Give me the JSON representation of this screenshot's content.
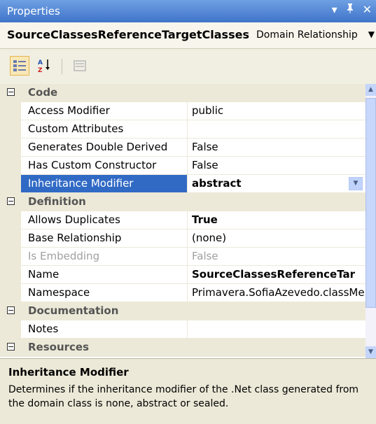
{
  "window": {
    "title": "Properties",
    "controls": {
      "dropdown": "▾",
      "pin": "ᵖ",
      "close": "✕"
    }
  },
  "selector": {
    "object_name": "SourceClassesReferenceTargetClasses",
    "object_type": "Domain Relationship"
  },
  "grid": {
    "categories": [
      {
        "label": "Code",
        "properties": [
          {
            "name": "Access Modifier",
            "value": "public"
          },
          {
            "name": "Custom Attributes",
            "value": ""
          },
          {
            "name": "Generates Double Derived",
            "value": "False"
          },
          {
            "name": "Has Custom Constructor",
            "value": "False"
          },
          {
            "name": "Inheritance Modifier",
            "value": "abstract"
          }
        ]
      },
      {
        "label": "Definition",
        "properties": [
          {
            "name": "Allows Duplicates",
            "value": "True"
          },
          {
            "name": "Base Relationship",
            "value": "(none)"
          },
          {
            "name": "Is Embedding",
            "value": "False"
          },
          {
            "name": "Name",
            "value": "SourceClassesReferenceTar"
          },
          {
            "name": "Namespace",
            "value": "Primavera.SofiaAzevedo.classMe"
          }
        ]
      },
      {
        "label": "Documentation",
        "properties": [
          {
            "name": "Notes",
            "value": ""
          }
        ]
      },
      {
        "label": "Resources",
        "properties": []
      }
    ]
  },
  "description": {
    "title": "Inheritance Modifier",
    "text": "Determines if the inheritance modifier of the .Net class generated from the domain class is none, abstract or sealed."
  }
}
